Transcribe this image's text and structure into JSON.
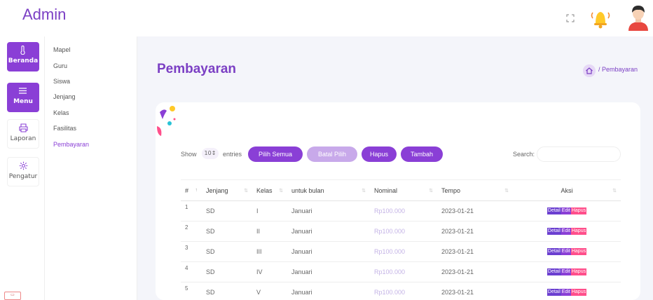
{
  "header": {
    "brand": "Admin",
    "fullscreen_icon": "fullscreen-icon",
    "notification_icon": "bell-icon",
    "user_icon": "avatar-icon"
  },
  "rail": [
    {
      "label": "Beranda",
      "icon": "thermometer-icon",
      "active": true
    },
    {
      "label": "Menu",
      "icon": "hamburger-icon",
      "active": true
    },
    {
      "label": "Laporan",
      "icon": "printer-icon",
      "active": false
    },
    {
      "label": "Pengatur",
      "icon": "gear-icon",
      "active": false
    }
  ],
  "submenu": [
    "Mapel",
    "Guru",
    "Siswa",
    "Jenjang",
    "Kelas",
    "Fasilitas",
    "Pembayaran"
  ],
  "submenu_active": "Pembayaran",
  "page": {
    "title": "Pembayaran",
    "breadcrumb": "/ Pembayaran"
  },
  "controls": {
    "show_label": "Show",
    "show_value": "10↕",
    "entries_label": "entries",
    "pilih_semua": "Pilih Semua",
    "batal_pilih": "Batal Pilih",
    "hapus": "Hapus",
    "tambah": "Tambah",
    "search_label": "Search:",
    "search_value": ""
  },
  "table": {
    "columns": [
      "#",
      "Jenjang",
      "Kelas",
      "untuk bulan",
      "Nominal",
      "Tempo",
      "Aksi"
    ],
    "rows": [
      [
        "1",
        "SD",
        "I",
        "Januari",
        "Rp100.000",
        "2023-01-21"
      ],
      [
        "2",
        "SD",
        "II",
        "Januari",
        "Rp100.000",
        "2023-01-21"
      ],
      [
        "3",
        "SD",
        "III",
        "Januari",
        "Rp100.000",
        "2023-01-21"
      ],
      [
        "4",
        "SD",
        "IV",
        "Januari",
        "Rp100.000",
        "2023-01-21"
      ],
      [
        "5",
        "SD",
        "V",
        "Januari",
        "Rp100.000",
        "2023-01-21"
      ]
    ],
    "actions": [
      "Detail",
      "Edit",
      "Hapus"
    ]
  },
  "colors": {
    "accent": "#8a3fd6",
    "accent_light": "#c8a9ea",
    "danger": "#ff4f8b",
    "background": "#f4f5fa"
  }
}
